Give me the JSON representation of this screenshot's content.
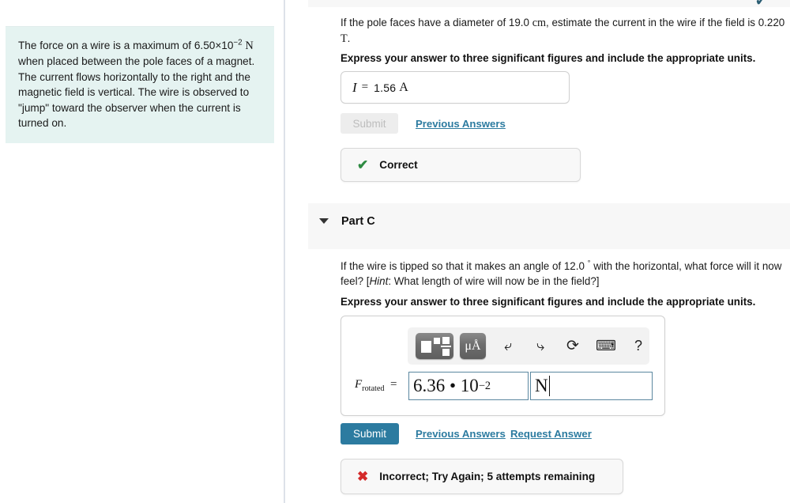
{
  "left_panel": {
    "problem_statement_parts": {
      "before_value": "The force on a wire is a maximum of 6.50×10",
      "exponent": "−2",
      "unit": "N",
      "rest": "when placed between the pole faces of a magnet. The current flows horizontally to the right and the magnetic field is vertical. The wire is observed to \"jump\" toward the observer when the current is turned on."
    }
  },
  "part_b": {
    "status_icon": "check-icon",
    "question_line1": "If the pole faces have a diameter of 19.0",
    "unit_cm": "cm",
    "question_line2": ", estimate the current in the wire if the field is",
    "question_line3": "0.220",
    "unit_T": "T",
    "question_line4": ".",
    "instruction": "Express your answer to three significant figures and include the appropriate units.",
    "answer_variable": "I",
    "equals": "=",
    "answer_value": "1.56",
    "answer_unit": "A",
    "submit_label": "Submit",
    "previous_answers_label": "Previous Answers",
    "feedback_icon": "check-icon",
    "feedback_text": "Correct",
    "feedback_color": "#2e8b42"
  },
  "part_c": {
    "caret_icon": "caret-down-icon",
    "title": "Part C",
    "question_a": "If the wire is tipped so that it makes an angle of 12.0",
    "degree_symbol": "°",
    "question_b": "with the horizontal, what force will it now feel? [",
    "hint_label": "Hint",
    "question_c": ": What length of wire will now be in the field?]",
    "instruction": "Express your answer to three significant figures and include the appropriate units.",
    "toolbar": {
      "template_button": "math-template-icon",
      "units_button": "μÅ",
      "undo_button": "undo-arrow-icon",
      "redo_button": "redo-arrow-icon",
      "reset_button": "reset-circle-icon",
      "keyboard_button": "keyboard-icon",
      "help_button": "?"
    },
    "answer_label_base": "F",
    "answer_label_sub": "rotated",
    "answer_equals": "=",
    "answer_value": "6.36 • 10",
    "answer_exponent": "−2",
    "answer_unit": "N",
    "submit_label": "Submit",
    "previous_answers_label": "Previous Answers",
    "request_answer_label": "Request Answer",
    "feedback_icon": "x-icon",
    "feedback_text": "Incorrect; Try Again; 5 attempts remaining",
    "feedback_color": "#d42a2a"
  },
  "colors": {
    "accent_blue": "#2c7ba0",
    "problem_bg": "#e5f3f1",
    "band_gray": "#f7f7f7",
    "correct_green": "#2e8b42",
    "incorrect_red": "#d42a2a"
  }
}
